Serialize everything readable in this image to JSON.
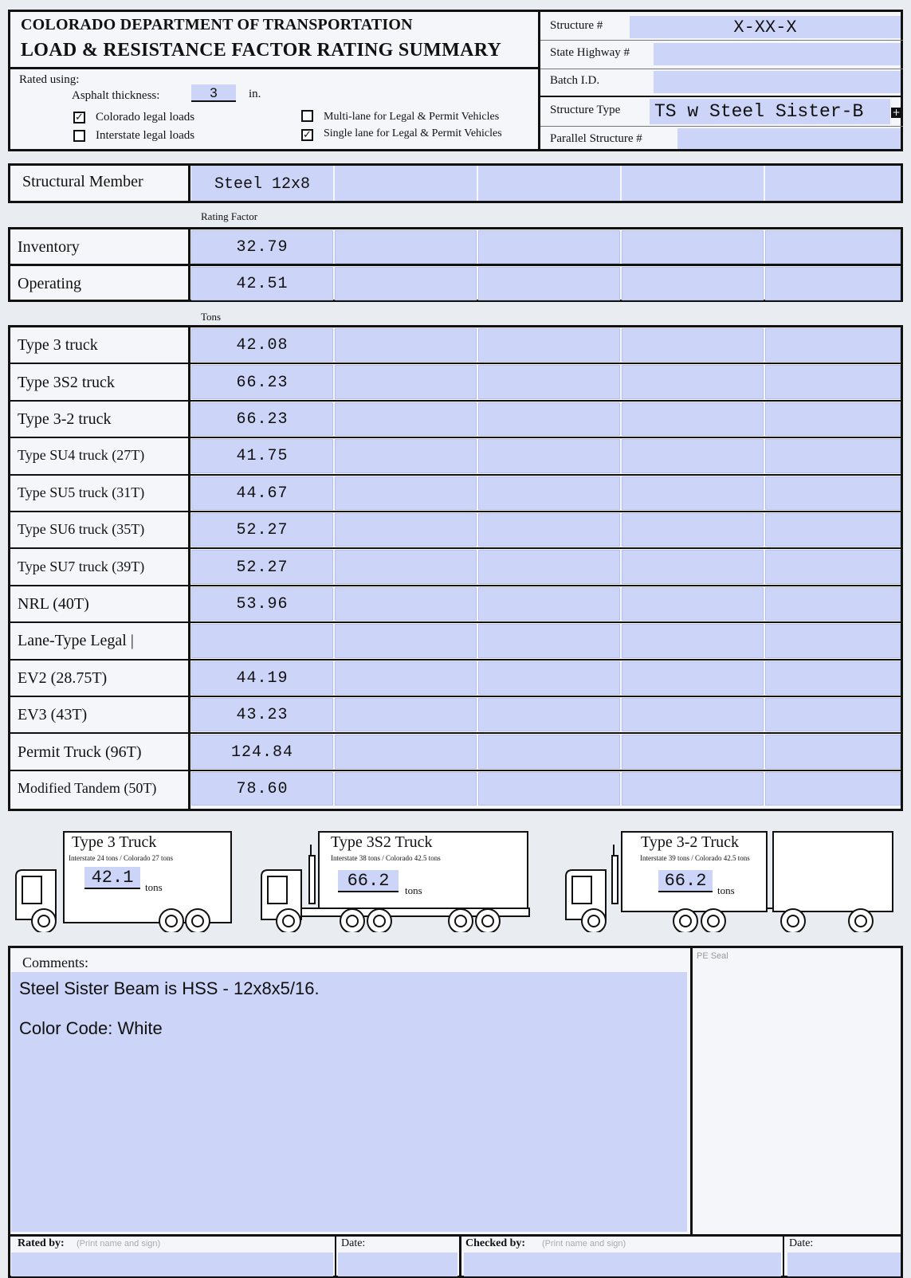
{
  "header": {
    "agency": "COLORADO DEPARTMENT OF TRANSPORTATION",
    "form_title": "LOAD & RESISTANCE FACTOR RATING SUMMARY",
    "rated_using": "Rated using:",
    "asphalt_label": "Asphalt thickness:",
    "asphalt_value": "3",
    "asphalt_unit": "in.",
    "options": [
      {
        "label": "Colorado legal  loads",
        "checked": true
      },
      {
        "label": "Interstate legal  loads",
        "checked": false
      },
      {
        "label": "Multi-lane for Legal & Permit Vehicles",
        "checked": false
      },
      {
        "label": "Single lane for Legal & Permit Vehicles",
        "checked": true
      }
    ],
    "structure_label": "Structure #",
    "structure_value": "X-XX-X",
    "highway_label": "State Highway #",
    "highway_value": "",
    "batch_label": "Batch I.D.",
    "batch_value": "",
    "type_label": "Structure Type",
    "type_value": "TS w Steel Sister-B",
    "parallel_label": "Parallel Structure #",
    "parallel_value": ""
  },
  "member": {
    "label": "Structural Member",
    "values": [
      "Steel 12x8",
      "",
      "",
      "",
      ""
    ]
  },
  "rating_caption": "Rating Factor",
  "rating_rows": [
    {
      "label": "Inventory",
      "value": "32.79"
    },
    {
      "label": "Operating",
      "value": "42.51"
    }
  ],
  "tons_caption": "Tons",
  "tons_rows": [
    {
      "label": "Type 3 truck",
      "value": "42.08"
    },
    {
      "label": "Type 3S2 truck",
      "value": "66.23"
    },
    {
      "label": "Type 3-2 truck",
      "value": "66.23"
    },
    {
      "label": "Type SU4 truck (27T)",
      "value": "41.75"
    },
    {
      "label": "Type SU5 truck (31T)",
      "value": "44.67"
    },
    {
      "label": "Type SU6 truck (35T)",
      "value": "52.27"
    },
    {
      "label": "Type SU7 truck (39T)",
      "value": "52.27"
    },
    {
      "label": "NRL (40T)",
      "value": "53.96"
    },
    {
      "label": "Lane-Type Legal |",
      "value": ""
    },
    {
      "label": "EV2 (28.75T)",
      "value": "44.19"
    },
    {
      "label": "EV3 (43T)",
      "value": "43.23"
    },
    {
      "label": "Permit Truck (96T)",
      "value": "124.84"
    },
    {
      "label": "Modified Tandem (50T)",
      "value": "78.60"
    }
  ],
  "trucks": [
    {
      "title": "Type 3 Truck",
      "sub": "Interstate 24 tons / Colorado 27 tons",
      "value": "42.1",
      "unit": "tons"
    },
    {
      "title": "Type 3S2 Truck",
      "sub": "Interstate 38 tons / Colorado 42.5 tons",
      "value": "66.2",
      "unit": "tons"
    },
    {
      "title": "Type 3-2 Truck",
      "sub": "Interstate 39 tons / Colorado 42.5 tons",
      "value": "66.2",
      "unit": "tons"
    }
  ],
  "comments": {
    "label": "Comments:",
    "line1": "Steel Sister Beam is HSS - 12x8x5/16.",
    "line2": "Color Code: White",
    "seal_label": "PE Seal"
  },
  "footer": {
    "rated_by": "Rated by:",
    "rated_hint": "(Print name and sign)",
    "date1": "Date:",
    "checked_by": "Checked by:",
    "checked_hint": "(Print name and sign)",
    "date2": "Date:"
  },
  "colors": {
    "field": "#ccd4f7",
    "border": "#111111",
    "paper": "#e9edf2"
  }
}
